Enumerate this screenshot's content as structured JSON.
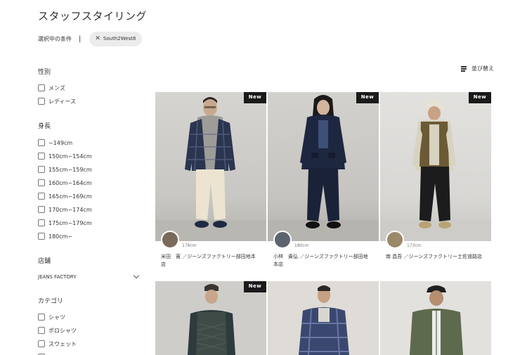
{
  "page": {
    "title": "スタッフスタイリング",
    "filter_label": "選択中の条件",
    "active_filter": "South2West8",
    "sort_label": "並び替え"
  },
  "sidebar": {
    "gender": {
      "title": "性別",
      "options": [
        "メンズ",
        "レディース"
      ]
    },
    "height": {
      "title": "身長",
      "options": [
        "~149cm",
        "150cm~154cm",
        "155cm~159cm",
        "160cm~164cm",
        "165cm~169cm",
        "170cm~174cm",
        "175cm~179cm",
        "180cm~"
      ]
    },
    "store": {
      "title": "店舗",
      "value": "JEANS FACTORY"
    },
    "category": {
      "title": "カテゴリ",
      "options": [
        "シャツ",
        "ポロシャツ",
        "スウェット"
      ]
    }
  },
  "cards": [
    {
      "new": "New",
      "height": "178cm",
      "staff_line1": "米田　寛 ／ジーンズファクトリー部田地本",
      "staff_line2": "店"
    },
    {
      "new": "New",
      "height": "180cm",
      "staff_line1": "小林　貴弘 ／ジーンズファクトリー部田地",
      "staff_line2": "本店"
    },
    {
      "new": "New",
      "height": "173cm",
      "staff_line1": "南 昌吾 ／ジーンズファクトリー土佐道路店",
      "staff_line2": ""
    },
    {
      "new": "New"
    },
    {
      "new": ""
    },
    {
      "new": ""
    }
  ],
  "colors": {
    "new_badge": "#1a1a1a",
    "chip_bg": "#ececec",
    "photo_bg": "#d4d2cf"
  }
}
